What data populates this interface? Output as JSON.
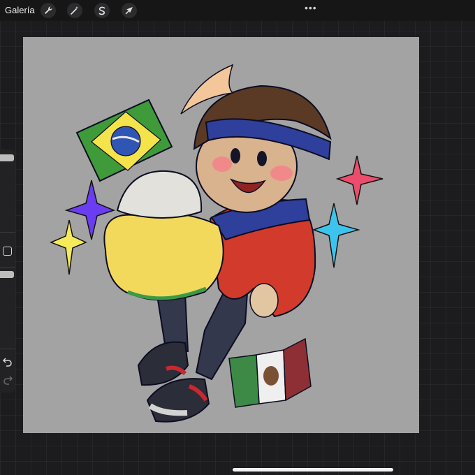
{
  "topbar": {
    "gallery_label": "Galería",
    "tools": [
      "wrench-icon",
      "magic-wand-icon",
      "selection-icon",
      "transform-arrow-icon"
    ],
    "more_label": "•••"
  },
  "sidebar": {
    "brush_size_level": 0.97,
    "opacity_level": 0.8,
    "tools": [
      "modify-square-icon",
      "undo-icon",
      "redo-icon"
    ]
  },
  "canvas": {
    "background": "#a3a3a3"
  },
  "colors": {
    "ui_background": "#1c1c1e",
    "toolbar": "#161616",
    "sidebar": "#222224"
  }
}
